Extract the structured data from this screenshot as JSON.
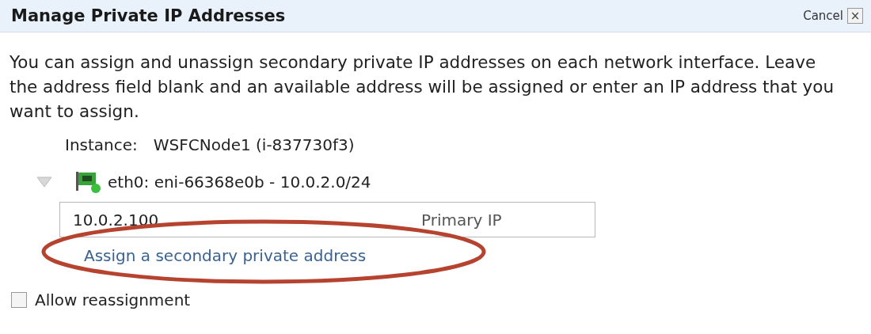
{
  "dialog": {
    "title": "Manage Private IP Addresses",
    "cancel": "Cancel",
    "close": "×"
  },
  "description": "You can assign and unassign secondary private IP addresses on each network interface. Leave the address field blank and an available address will be assigned or enter an IP address that you want to assign.",
  "instance": {
    "label": "Instance:",
    "value": "WSFCNode1 (i-837730f3)"
  },
  "interface": {
    "label": "eth0: eni-66368e0b - 10.0.2.0/24",
    "expanded": true,
    "addresses": [
      {
        "value": "10.0.2.100",
        "tag": "Primary IP"
      }
    ],
    "assign_link": "Assign a secondary private address",
    "highlighted": true
  },
  "allow_reassignment": {
    "label": "Allow reassignment",
    "checked": false
  }
}
